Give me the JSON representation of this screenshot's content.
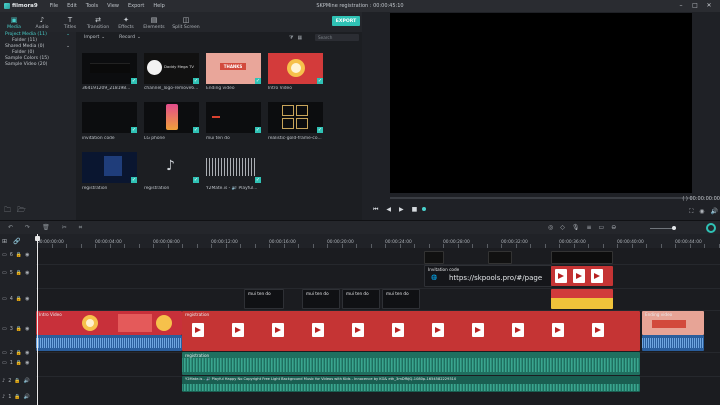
{
  "app": {
    "name": "filmora9",
    "window_title": "SKPMine registration : 00:00:45:10",
    "menu": [
      "File",
      "Edit",
      "Tools",
      "View",
      "Export",
      "Help"
    ]
  },
  "tabs": [
    "Media",
    "Audio",
    "Titles",
    "Transition",
    "Effects",
    "Elements",
    "Split Screen"
  ],
  "export_label": "EXPORT",
  "library": [
    {
      "label": "Project Media (11)",
      "sub": false,
      "selected": true
    },
    {
      "label": "Folder (11)",
      "sub": true,
      "selected": false
    },
    {
      "label": "Shared Media (0)",
      "sub": false,
      "selected": false
    },
    {
      "label": "Folder (0)",
      "sub": true,
      "selected": false
    },
    {
      "label": "Sample Colors (15)",
      "sub": false,
      "selected": false
    },
    {
      "label": "Sample Video (20)",
      "sub": false,
      "selected": false
    }
  ],
  "media_bar": {
    "import": "Import",
    "record": "Record",
    "search_placeholder": "Search"
  },
  "media_items": [
    {
      "label": "364191209_218198..."
    },
    {
      "label": "channel_logo-remove6...",
      "overlay": "Daddy Mega TV"
    },
    {
      "label": "Ending video",
      "overlay": "THANKS"
    },
    {
      "label": "Intro Video"
    },
    {
      "label": "invitation code"
    },
    {
      "label": "LG phone"
    },
    {
      "label": "mui ten do"
    },
    {
      "label": "realistic-gold-frame-co..."
    },
    {
      "label": "registration"
    },
    {
      "label": "registration"
    },
    {
      "label": "Y2Mate.is - 🔊 Playful..."
    }
  ],
  "preview": {
    "timecode": "00:00:00:00",
    "ratio": "( )"
  },
  "ruler": {
    "labels": [
      "00:00:00:00",
      "00:00:04:00",
      "00:00:08:00",
      "00:00:12:00",
      "00:00:16:00",
      "00:00:20:00",
      "00:00:24:00",
      "00:00:28:00",
      "00:00:32:00",
      "00:00:36:00",
      "00:00:40:00",
      "00:00:44:00"
    ]
  },
  "tracks": {
    "headers": [
      "6",
      "5",
      "4",
      "3",
      "2",
      "1",
      "2",
      "1"
    ]
  },
  "clips": {
    "invitation_label": "Invitation code",
    "url_overlay": "https://skpools.pro/#/page",
    "arrow_label": "mui ten do",
    "intro_label": "Intro Video",
    "registration_label": "registration",
    "ending_label": "Ending video",
    "music_label": "Y2Mate.is - 🔊 Playful Happy No Copyright Free Light Background Music for Videos with Kids - Innocence by KG& eth_3mDfNjQ-1080p-1654582229310"
  },
  "colors": {
    "accent": "#2fc2b5",
    "clip_red": "#c53434",
    "audio_green": "#2c8c79"
  }
}
